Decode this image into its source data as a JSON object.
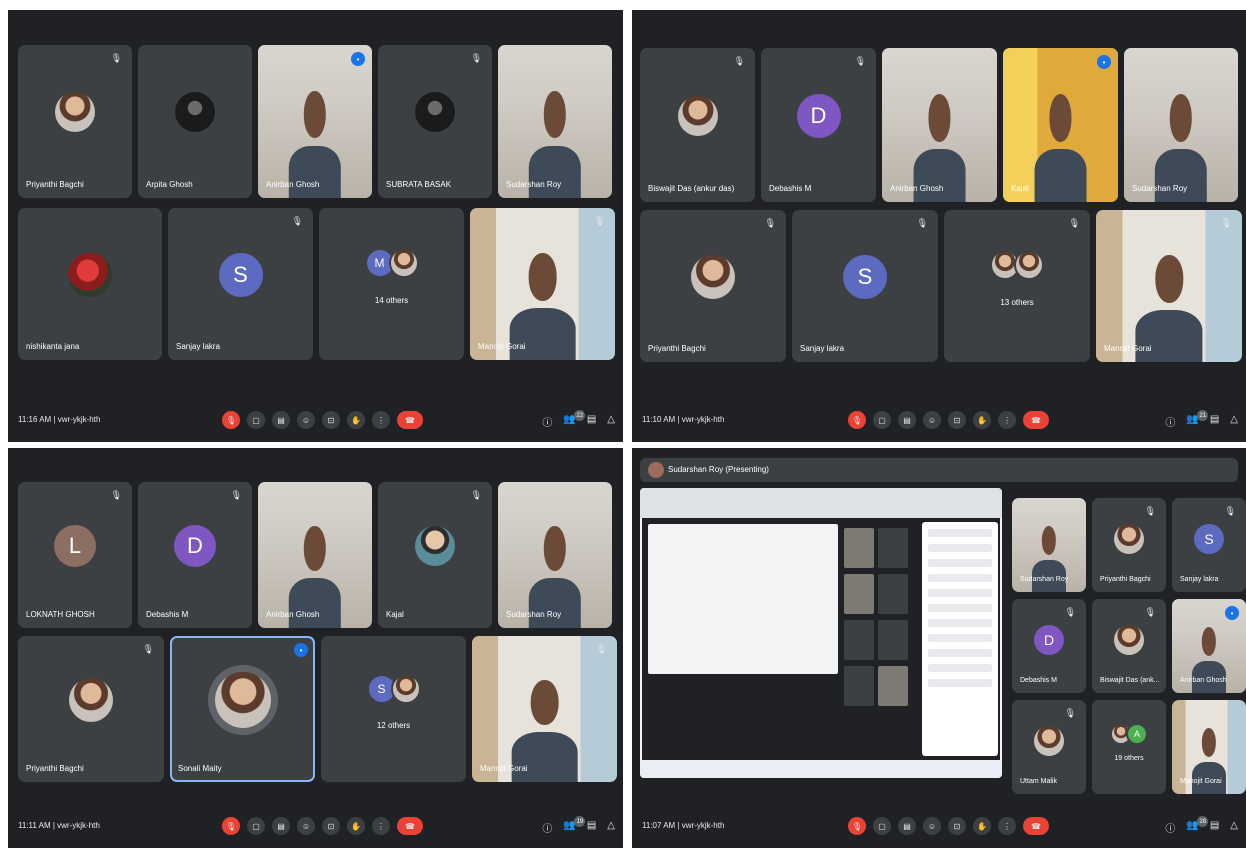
{
  "panels": [
    {
      "time": "11:16 AM",
      "code": "vwr-ykjk-hth",
      "participants_count": "22",
      "tiles": [
        {
          "name": "Priyanthi Bagchi",
          "type": "photo"
        },
        {
          "name": "Arpita Ghosh",
          "type": "photo"
        },
        {
          "name": "Anirban Ghosh",
          "type": "video"
        },
        {
          "name": "SUBRATA BASAK",
          "type": "photo"
        },
        {
          "name": "Sudarshan Roy",
          "type": "video"
        },
        {
          "name": "nishikanta jana",
          "type": "photo"
        },
        {
          "name": "Sanjay lakra",
          "type": "letter",
          "letter": "S",
          "color": "#5c6bc0"
        },
        {
          "name": "14 others",
          "type": "others",
          "letter": "M",
          "color": "#5c6bc0"
        },
        {
          "name": "Manojit Gorai",
          "type": "video"
        }
      ]
    },
    {
      "time": "11:10 AM",
      "code": "vwr-ykjk-hth",
      "participants_count": "21",
      "tiles": [
        {
          "name": "Biswajit Das (ankur das)",
          "type": "photo"
        },
        {
          "name": "Debashis M",
          "type": "letter",
          "letter": "D",
          "color": "#7e57c2"
        },
        {
          "name": "Anirban Ghosh",
          "type": "video"
        },
        {
          "name": "Kajal",
          "type": "video"
        },
        {
          "name": "Sudarshan Roy",
          "type": "video"
        },
        {
          "name": "Priyanthi Bagchi",
          "type": "photo"
        },
        {
          "name": "Sanjay lakra",
          "type": "letter",
          "letter": "S",
          "color": "#5c6bc0"
        },
        {
          "name": "13 others",
          "type": "others"
        },
        {
          "name": "Manojit Gorai",
          "type": "video"
        }
      ]
    },
    {
      "time": "11:11 AM",
      "code": "vwr-ykjk-hth",
      "participants_count": "19",
      "tiles": [
        {
          "name": "LOKNATH GHOSH",
          "type": "letter",
          "letter": "L",
          "color": "#8d6e63"
        },
        {
          "name": "Debashis M",
          "type": "letter",
          "letter": "D",
          "color": "#7e57c2"
        },
        {
          "name": "Anirban Ghosh",
          "type": "video"
        },
        {
          "name": "Kajal",
          "type": "photo"
        },
        {
          "name": "Sudarshan Roy",
          "type": "video"
        },
        {
          "name": "Priyanthi Bagchi",
          "type": "photo"
        },
        {
          "name": "Sonali Maity",
          "type": "photo"
        },
        {
          "name": "12 others",
          "type": "others",
          "letter": "S",
          "color": "#5c6bc0"
        },
        {
          "name": "Manojit Gorai",
          "type": "video"
        }
      ]
    },
    {
      "time": "11:07 AM",
      "code": "vwr-ykjk-hth",
      "participants_count": "28",
      "presenter": "Sudarshan Roy (Presenting)",
      "tiles": [
        {
          "name": "Sudarshan Roy",
          "type": "video"
        },
        {
          "name": "Priyanthi Bagchi",
          "type": "photo"
        },
        {
          "name": "Sanjay lakra",
          "type": "letter",
          "letter": "S",
          "color": "#5c6bc0"
        },
        {
          "name": "Debashis M",
          "type": "letter",
          "letter": "D",
          "color": "#7e57c2"
        },
        {
          "name": "Biswajit Das (ank...",
          "type": "photo"
        },
        {
          "name": "Anirban Ghosh",
          "type": "video"
        },
        {
          "name": "Uttam Malik",
          "type": "photo"
        },
        {
          "name": "19 others",
          "type": "others"
        },
        {
          "name": "Manojit Gorai",
          "type": "video"
        }
      ]
    }
  ],
  "icons": [
    "mic-off-icon",
    "present-icon",
    "captions-icon",
    "emoji-icon",
    "share-screen-icon",
    "hand-icon",
    "more-icon",
    "end-call-icon",
    "info-icon",
    "people-icon",
    "chat-icon",
    "activities-icon"
  ]
}
